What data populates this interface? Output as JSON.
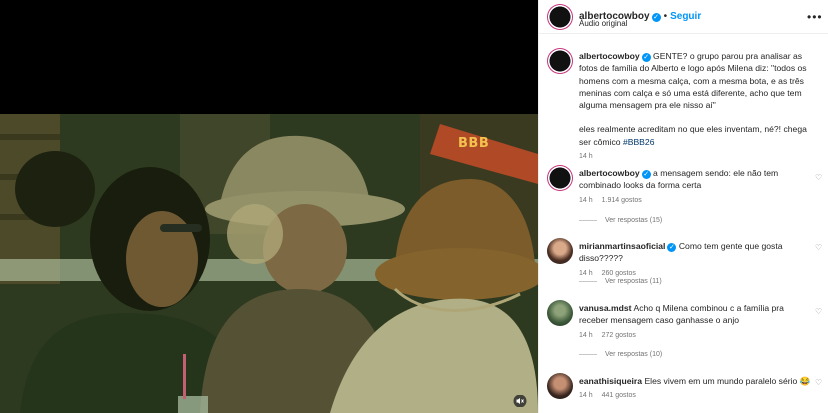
{
  "video": {
    "watermark": "BBB",
    "mute_icon": "speaker-muted-icon"
  },
  "header": {
    "username": "albertocowboy",
    "verified_icon": "verified-badge-icon",
    "separator": "•",
    "follow_label": "Seguir",
    "audio_label": "Áudio original",
    "more_icon": "more-options-icon"
  },
  "caption": {
    "username": "albertocowboy",
    "text": "GENTE? o grupo parou pra analisar as fotos de família do Alberto e logo após Milena diz: \"todos os homens com a mesma calça, com a mesma bota, e as três meninas com calça e só uma está diferente, acho que tem alguma mensagem pra ele nisso aí\"",
    "text2": "eles realmente acreditam no que eles inventam, né?! chega ser cômico",
    "hashtag": "#BBB26",
    "time": "14 h"
  },
  "comments": [
    {
      "username": "albertocowboy",
      "verified": true,
      "text": "a mensagem sendo: ele não tem combinado looks da forma certa",
      "time": "14 h",
      "likes": "1.914 gostos",
      "replies": "Ver respostas (15)"
    },
    {
      "username": "mirianmartinsaoficial",
      "verified": true,
      "text": "Como tem gente que gosta disso?????",
      "time": "14 h",
      "likes": "260 gostos",
      "replies": "Ver respostas (11)"
    },
    {
      "username": "vanusa.mdst",
      "verified": false,
      "text": "Acho q Milena combinou c a família pra receber mensagem caso ganhasse o anjo",
      "time": "14 h",
      "likes": "272 gostos",
      "replies": "Ver respostas (10)"
    },
    {
      "username": "eanathisiqueira",
      "verified": false,
      "text": "Eles vivem em um mundo paralelo sério 😂",
      "time": "14 h",
      "likes": "441 gostos"
    }
  ],
  "colors": {
    "accent": "#0095f6",
    "hashtag": "#00376b",
    "muted": "#737373"
  }
}
